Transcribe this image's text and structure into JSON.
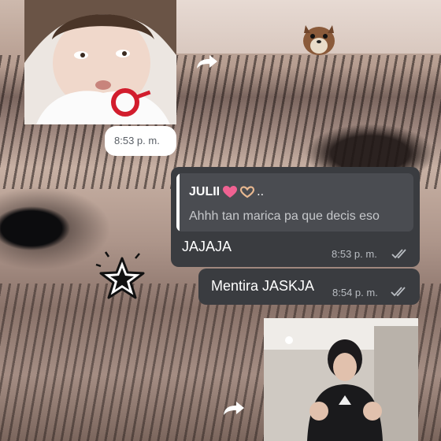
{
  "messages": {
    "top_photo_time": "8:53 p. m.",
    "reply": {
      "quoted_author": "JULII",
      "quoted_author_suffix": "..",
      "quoted_text": "Ahhh tan marica pa que decis eso",
      "text": "JAJAJA",
      "time": "8:53 p. m."
    },
    "second": {
      "text": "Mentira JASKJA",
      "time": "8:54 p. m."
    }
  },
  "icons": {
    "forward": "forward-arrow-icon",
    "double_check": "double-check-icon",
    "heart": "pink-heart-emoji",
    "heart_hands": "heart-hands-emoji",
    "star_sticker": "star-sticker",
    "squirrel_sticker": "squirrel-sticker"
  },
  "colors": {
    "bubble_out": "#3a3c40",
    "bubble_in": "#ffffff",
    "quote_bar": "#ffffff",
    "time_text": "#b9bdc2",
    "tick": "#b9bdc2"
  }
}
